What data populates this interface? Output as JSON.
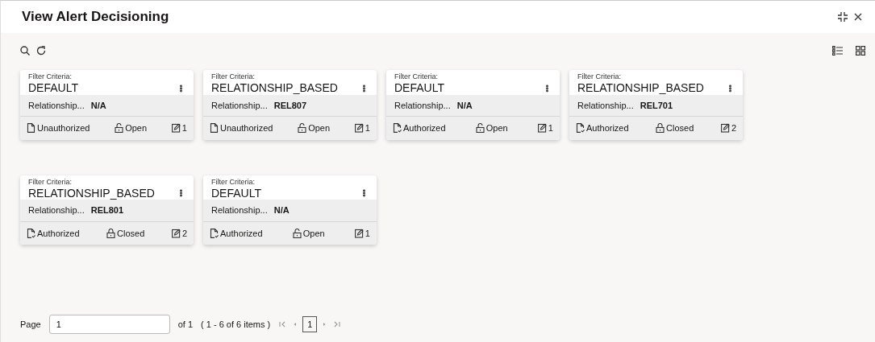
{
  "window": {
    "title": "View Alert Decisioning"
  },
  "cards": [
    {
      "label": "Filter Criteria:",
      "value": "DEFAULT",
      "field_label": "Relationship...",
      "field_value": "N/A",
      "auth": {
        "kind": "unauthorized",
        "text": "Unauthorized"
      },
      "lock": {
        "kind": "open",
        "text": "Open"
      },
      "count": "1"
    },
    {
      "label": "Filter Criteria:",
      "value": "RELATIONSHIP_BASED",
      "field_label": "Relationship...",
      "field_value": "REL807",
      "auth": {
        "kind": "unauthorized",
        "text": "Unauthorized"
      },
      "lock": {
        "kind": "open",
        "text": "Open"
      },
      "count": "1"
    },
    {
      "label": "Filter Criteria:",
      "value": "DEFAULT",
      "field_label": "Relationship...",
      "field_value": "N/A",
      "auth": {
        "kind": "authorized",
        "text": "Authorized"
      },
      "lock": {
        "kind": "open",
        "text": "Open"
      },
      "count": "1"
    },
    {
      "label": "Filter Criteria:",
      "value": "RELATIONSHIP_BASED",
      "field_label": "Relationship...",
      "field_value": "REL701",
      "auth": {
        "kind": "authorized",
        "text": "Authorized"
      },
      "lock": {
        "kind": "closed",
        "text": "Closed"
      },
      "count": "2"
    },
    {
      "label": "Filter Criteria:",
      "value": "RELATIONSHIP_BASED",
      "field_label": "Relationship...",
      "field_value": "REL801",
      "auth": {
        "kind": "authorized",
        "text": "Authorized"
      },
      "lock": {
        "kind": "closed",
        "text": "Closed"
      },
      "count": "2"
    },
    {
      "label": "Filter Criteria:",
      "value": "DEFAULT",
      "field_label": "Relationship...",
      "field_value": "N/A",
      "auth": {
        "kind": "authorized",
        "text": "Authorized"
      },
      "lock": {
        "kind": "open",
        "text": "Open"
      },
      "count": "1"
    }
  ],
  "pagination": {
    "label": "Page",
    "value": "1",
    "of": "of 1",
    "items": "( 1 - 6 of 6 items )",
    "pages": [
      {
        "label": "1",
        "selected": true
      }
    ]
  }
}
